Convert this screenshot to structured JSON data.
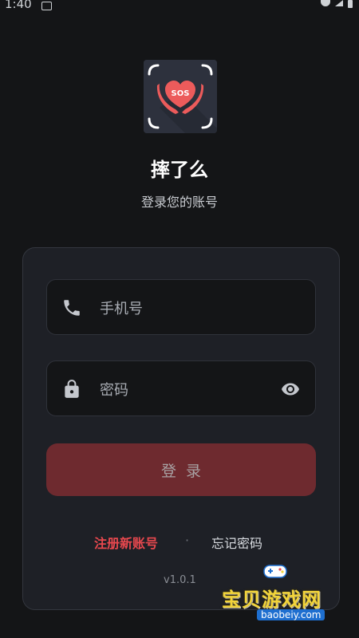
{
  "status_bar": {
    "time": "1:40"
  },
  "app": {
    "name": "摔了么",
    "subtitle": "登录您的账号",
    "logo_text": "SOS"
  },
  "form": {
    "phone_placeholder": "手机号",
    "password_placeholder": "密码",
    "login_label": "登录",
    "register_link": "注册新账号",
    "separator": "·",
    "forgot_link": "忘记密码",
    "version": "v1.0.1"
  },
  "watermark": {
    "title": "宝贝游戏网",
    "url": "baobeiy.com"
  },
  "colors": {
    "background": "#141517",
    "card": "#1e2026",
    "accent_red": "#e8484e",
    "button_disabled": "#6e2a2f"
  }
}
